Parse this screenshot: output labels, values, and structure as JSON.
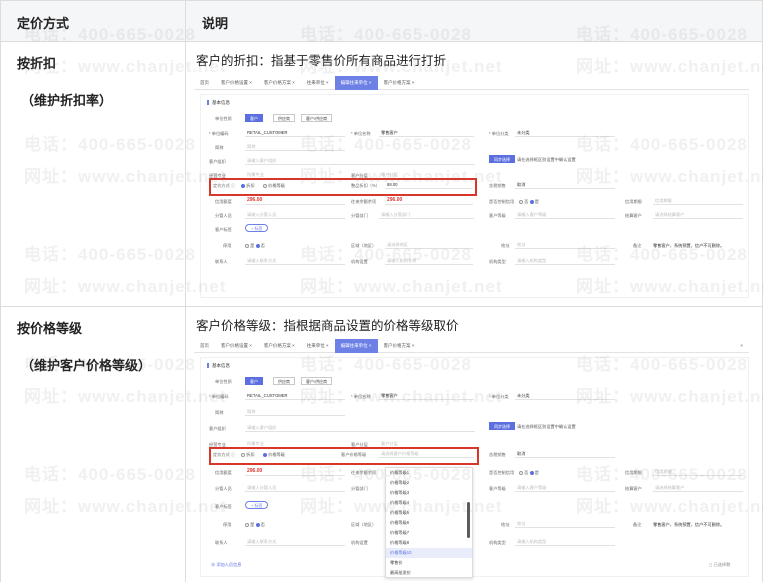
{
  "header": {
    "col1": "定价方式",
    "col2": "说明"
  },
  "rows": [
    {
      "method": "按折扣",
      "sub": "（维护折扣率）",
      "desc": "客户的折扣：指基于零售价所有商品进行打折",
      "shot": {
        "tabs": [
          "首页",
          "客户价格设置 ×",
          "客户价格方案 ×",
          "往来单位 ×",
          "编辑往来单位 ×",
          "客户价格方案 ×"
        ],
        "section": "基本信息",
        "unit_type_label": "单位性质",
        "unit_type_opts": [
          "客户",
          "供应商",
          "客户/供应商"
        ],
        "code_label": "* 单位编码",
        "code_val": "RETAIL_CUSTOMER",
        "name_label": "* 单位名称",
        "name_val": "零售客户",
        "class_label": "* 单位分类",
        "class_val": "未分类",
        "abbr_label": "简称",
        "abbr_ph": "简称",
        "group_label": "客户组织",
        "group_ph": "请输入客户组织",
        "select_btn": "同步选择",
        "select_hint": "请在选择框区别设置中确认设置",
        "dept_label": "经营专业",
        "dept_ph": "所属专业",
        "cust_attr_label": "客户分层",
        "cust_attr_ph": "客户分层",
        "price_label": "定价方式 ⓘ",
        "price_opt1": "折扣",
        "price_opt2": "价格等级",
        "discount_label": "整品折扣（%）",
        "discount_val": "88.00",
        "tax_label": "含税销售",
        "tax_val": "取消",
        "credit_label": "信用额度",
        "credit_val": "296.00",
        "balance_label": "往来余额余项",
        "balance_val": "296.00",
        "ctrl_label": "是否控制信用",
        "ctrl_opts": [
          "否",
          "是"
        ],
        "credit_days_label": "信用期限",
        "credit_days_ph": "信用期限",
        "sales_label": "分管人员",
        "sales_ph": "请输入分管人员",
        "dept2_label": "分管部门",
        "dept2_ph": "请输入分管部门",
        "level_label": "客户等级",
        "level_ph": "请输入客户等级",
        "clearing_label": "结算客户",
        "clearing_ph": "请选择结算客户",
        "tag_label": "客户标签",
        "tag_btn": "+ 标签",
        "stop_label": "停用",
        "stop_opts": [
          "是",
          "否"
        ],
        "area_label": "区域（地区）",
        "area_ph": "请选择地区",
        "addr_label": "地址",
        "addr_ph": "地址",
        "remark_label": "备注",
        "remark_val": "零售客户，系统预置，信户不可删除。",
        "contact_label": "联系人",
        "contact_ph": "请输入联系方式",
        "phone_label": "机构设置",
        "phone_ph": "请输入机构名称",
        "inst_label": "机构类型",
        "inst_ph": "请输入机构类型"
      }
    },
    {
      "method": "按价格等级",
      "sub": "（维护客户价格等级）",
      "desc": "客户价格等级：指根据商品设置的价格等级取价",
      "shot": {
        "price_level_label": "客户价格等级",
        "price_level_ph": "请选择客户价格等级",
        "dropdown": [
          "价格等级1",
          "价格等级2",
          "价格等级3",
          "价格等级4",
          "价格等级5",
          "价格等级6",
          "价格等级7",
          "价格等级8",
          "价格等级10",
          "零售价",
          "最高批发价"
        ],
        "dropdown_selected": 8,
        "add_btn": "⊕ 添加人员信息",
        "footer_right": "◻ 已选择数"
      }
    }
  ],
  "watermarks": {
    "phone": "电话：400-665-0028",
    "site": "网址：www.chanjet.net"
  }
}
